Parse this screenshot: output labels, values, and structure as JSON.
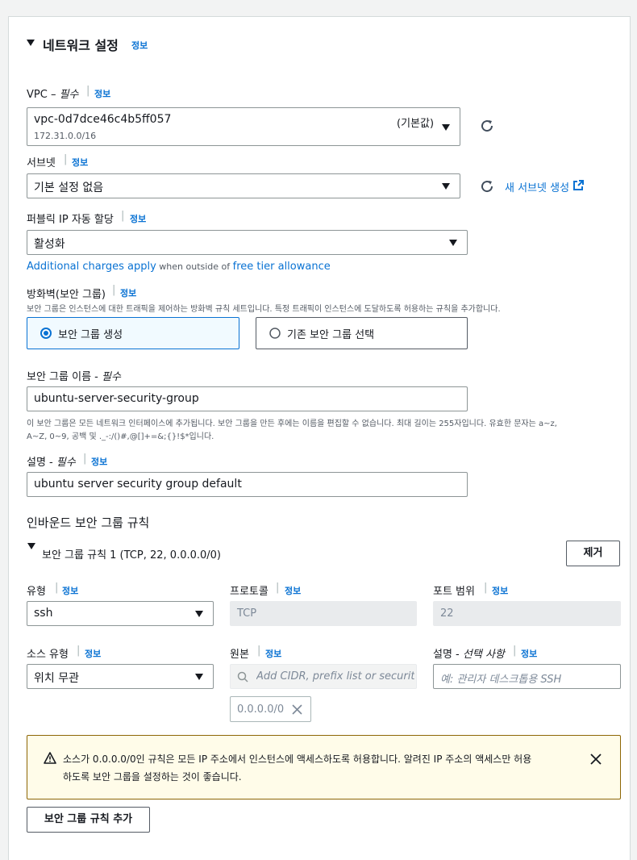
{
  "section": {
    "title": "네트워크 설정",
    "info": "정보"
  },
  "vpc": {
    "label": "VPC",
    "dash": "–",
    "required": "필수",
    "info": "정보",
    "value": "vpc-0d7dce46c4b5ff057",
    "cidr": "172.31.0.0/16",
    "default_tag": "(기본값)"
  },
  "subnet": {
    "label": "서브넷",
    "info": "정보",
    "value": "기본 설정 없음",
    "create_link": "새 서브넷 생성"
  },
  "public_ip": {
    "label": "퍼블릭 IP 자동 할당",
    "info": "정보",
    "value": "활성화",
    "charges_link": "Additional charges apply",
    "charges_mid": " when outside of ",
    "free_tier_link": "free tier allowance"
  },
  "firewall": {
    "label": "방화벽(보안 그룹)",
    "info": "정보",
    "description": "보안 그룹은 인스턴스에 대한 트래픽을 제어하는 방화벽 규칙 세트입니다. 특정 트래픽이 인스턴스에 도달하도록 허용하는 규칙을 추가합니다.",
    "option_create": "보안 그룹 생성",
    "option_existing": "기존 보안 그룹 선택",
    "selected": "보안 그룹 생성"
  },
  "sg_name": {
    "label": "보안 그룹 이름 -",
    "required": "필수",
    "value": "ubuntu-server-security-group",
    "hint_line1": "이 보안 그룹은 모든 네트워크 인터페이스에 추가됩니다. 보안 그룹을 만든 후에는 이름을 편집할 수 없습니다. 최대 길이는 255자입니다. 유효한 문자는 a~z,",
    "hint_line2": "A~Z, 0~9, 공백 및 ._-:/()#,@[]+=&;{}!$*입니다."
  },
  "sg_desc": {
    "label": "설명 -",
    "required": "필수",
    "info": "정보",
    "value": "ubuntu server security group default"
  },
  "inbound": {
    "title": "인바운드 보안 그룹 규칙",
    "rule_title": "보안 그룹 규칙 1 (TCP, 22, 0.0.0.0/0)",
    "remove_button": "제거",
    "type_label": "유형",
    "type_info": "정보",
    "type_value": "ssh",
    "protocol_label": "프로토콜",
    "protocol_info": "정보",
    "protocol_value": "TCP",
    "port_label": "포트 범위",
    "port_info": "정보",
    "port_value": "22",
    "source_type_label": "소스 유형",
    "source_type_info": "정보",
    "source_type_value": "위치 무관",
    "source_label": "원본",
    "source_info": "정보",
    "source_placeholder": "Add CIDR, prefix list or security",
    "source_token": "0.0.0.0/0",
    "desc_label": "설명 -",
    "desc_optional": "선택 사항",
    "desc_info": "정보",
    "desc_placeholder": "예: 관리자 데스크톱용 SSH"
  },
  "warning": {
    "line1": "소스가 0.0.0.0/0인 규칙은 모든 IP 주소에서 인스턴스에 액세스하도록 허용합니다. 알려진 IP 주소의 액세스만 허용",
    "line2": "하도록 보안 그룹을 설정하는 것이 좋습니다."
  },
  "add_rule_button": "보안 그룹 규칙 추가",
  "colors": {
    "link": "#0972d3",
    "selected_bg": "#f1faff",
    "warning_bg": "#fffce9",
    "warning_border": "#8d6605"
  }
}
